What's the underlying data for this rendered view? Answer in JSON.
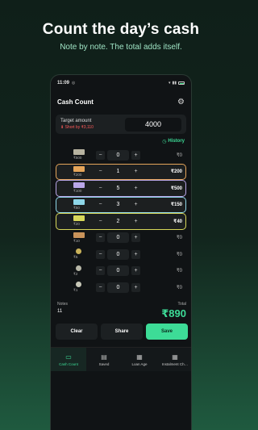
{
  "promo": {
    "headline": "Count the day’s cash",
    "subline": "Note by note. The total adds itself."
  },
  "status_bar": {
    "time": "11:09",
    "battery": "72"
  },
  "app": {
    "title": "Cash Count"
  },
  "target": {
    "label": "Target amount",
    "short_text": "Short by ₹3,110",
    "value": "4000"
  },
  "history_label": "History",
  "denominations": [
    {
      "label": "₹500",
      "count": "0",
      "total": "₹0",
      "active": false,
      "color": "#b7b3a0",
      "type": "note"
    },
    {
      "label": "₹200",
      "count": "1",
      "total": "₹200",
      "active": true,
      "color": "#e5a55a",
      "type": "note"
    },
    {
      "label": "₹100",
      "count": "5",
      "total": "₹500",
      "active": true,
      "color": "#b9a6e8",
      "type": "note"
    },
    {
      "label": "₹50",
      "count": "3",
      "total": "₹150",
      "active": true,
      "color": "#8ed6e8",
      "type": "note"
    },
    {
      "label": "₹20",
      "count": "2",
      "total": "₹40",
      "active": true,
      "color": "#d8d85a",
      "type": "note"
    },
    {
      "label": "₹10",
      "count": "0",
      "total": "₹0",
      "active": false,
      "color": "#c9935a",
      "type": "note"
    },
    {
      "label": "₹5",
      "count": "0",
      "total": "₹0",
      "active": false,
      "color": "#c9b25a",
      "type": "coin"
    },
    {
      "label": "₹2",
      "count": "0",
      "total": "₹0",
      "active": false,
      "color": "#b8b8a8",
      "type": "coin"
    },
    {
      "label": "₹1",
      "count": "0",
      "total": "₹0",
      "active": false,
      "color": "#c8c8b8",
      "type": "coin"
    }
  ],
  "summary": {
    "notes_label": "Notes",
    "notes_value": "11",
    "total_label": "Total",
    "total_value": "₹890"
  },
  "actions": {
    "clear": "Clear",
    "share": "Share",
    "save": "Save"
  },
  "nav": [
    {
      "label": "Cash Count",
      "icon": "cash-icon",
      "active": true
    },
    {
      "label": "Saved",
      "icon": "saved-icon",
      "active": false
    },
    {
      "label": "Loan Age",
      "icon": "calendar-icon",
      "active": false
    },
    {
      "label": "Instalment Ch…",
      "icon": "grid-icon",
      "active": false
    }
  ],
  "colors": {
    "accent": "#3ddc97",
    "border_200": "#e5a55a",
    "border_100": "#b9a6e8",
    "border_50": "#8ed6e8",
    "border_20": "#d8d85a",
    "short_red": "#ff5a5a"
  }
}
